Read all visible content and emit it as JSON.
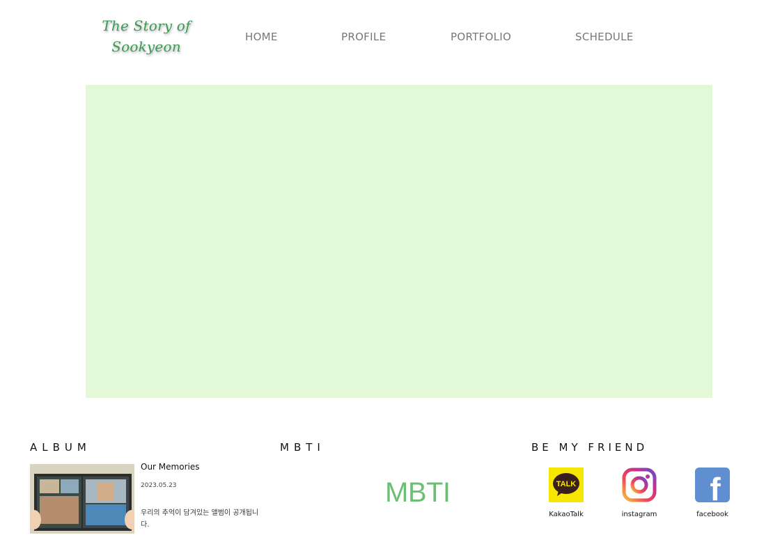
{
  "header": {
    "logo_line1": "The Story of",
    "logo_line2": "Sookyeon",
    "nav": {
      "home": "HOME",
      "profile": "PROFILE",
      "portfolio": "PORTFOLIO",
      "schedule": "SCHEDULE"
    }
  },
  "hero": {
    "background_color": "#e3f8d7"
  },
  "album": {
    "section_title": "ALBUM",
    "title": "Our Memories",
    "date": "2023.05.23",
    "description": "우리의 추억이 담겨있는 앨범이 공개됩니다."
  },
  "mbti": {
    "section_title": "MBTI",
    "text": "MBTI",
    "color": "#6cbf72"
  },
  "friend": {
    "section_title": "BE MY FRIEND",
    "links": [
      {
        "label": "KakaoTalk",
        "icon": "kakaotalk-icon",
        "badge": "TALK"
      },
      {
        "label": "instagram",
        "icon": "instagram-icon"
      },
      {
        "label": "facebook",
        "icon": "facebook-icon",
        "badge": "f"
      }
    ]
  },
  "colors": {
    "brand_green": "#3c9a55",
    "nav_gray": "#777777"
  }
}
